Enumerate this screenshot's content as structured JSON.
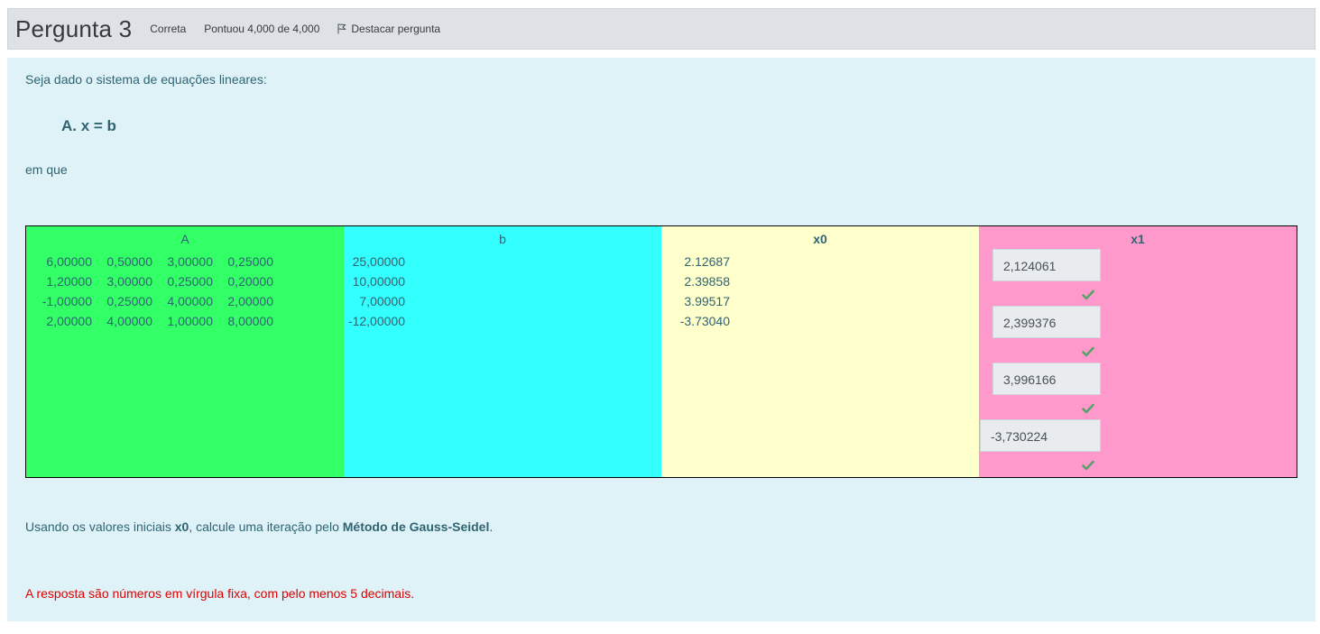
{
  "question": {
    "title_word": "Pergunta",
    "number": "3",
    "status": "Correta",
    "score": "Pontuou 4,000 de 4,000",
    "flag_label": "Destacar pergunta"
  },
  "content": {
    "intro": "Seja dado o sistema de equações lineares:",
    "formula": "A. x = b",
    "em_que": "em que",
    "task_pre": "Usando os valores iniciais ",
    "task_x0": "x0",
    "task_mid": ", calcule uma iteração pelo ",
    "task_method": "Método de Gauss-Seidel",
    "task_end": ".",
    "note": "A resposta são números em vírgula fixa, com pelo menos 5 decimais."
  },
  "table": {
    "headers": {
      "a": "A",
      "b": "b",
      "x0": "x0",
      "x1": "x1"
    },
    "colors": {
      "a": "#33ff66",
      "b": "#33ffff",
      "x0": "#ffffcc",
      "x1": "#ff99cc"
    },
    "A": [
      [
        "6,00000",
        "0,50000",
        "3,00000",
        "0,25000"
      ],
      [
        "1,20000",
        "3,00000",
        "0,25000",
        "0,20000"
      ],
      [
        "-1,00000",
        "0,25000",
        "4,00000",
        "2,00000"
      ],
      [
        "2,00000",
        "4,00000",
        "1,00000",
        "8,00000"
      ]
    ],
    "b": [
      "25,00000",
      "10,00000",
      "7,00000",
      "-12,00000"
    ],
    "x0": [
      "2.12687",
      "2.39858",
      "3.99517",
      "-3.73040"
    ],
    "x1": [
      "2,124061",
      "2,399376",
      "3,996166",
      "-3,730224"
    ],
    "x1_status": [
      "correct",
      "correct",
      "correct",
      "correct"
    ],
    "check_icon": "check-icon"
  }
}
